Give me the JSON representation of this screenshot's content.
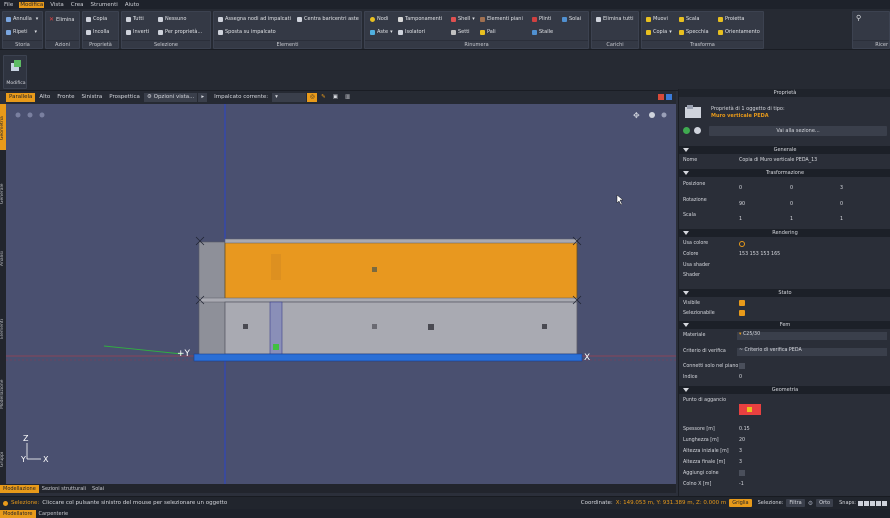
{
  "menu": [
    "File",
    "Modifica",
    "Vista",
    "Crea",
    "Strumenti",
    "Aiuto"
  ],
  "ribbon": {
    "storia": {
      "title": "Storia",
      "annulla": "Annulla",
      "ripeti": "Ripeti"
    },
    "azioni": {
      "title": "Azioni",
      "elimina": "Elimina"
    },
    "proprieta": {
      "title": "Proprietà",
      "copia": "Copia",
      "incolla": "Incolla"
    },
    "selezione": {
      "title": "Selezione",
      "tutti": "Tutti",
      "nessuno": "Nessuno",
      "inverti": "Inverti",
      "per_proprieta": "Per proprietà..."
    },
    "elementi": {
      "title": "Elementi",
      "assegna": "Assegna nodi ad impalcati",
      "centra": "Centra baricentri aste",
      "sposta": "Sposta su impalcato"
    },
    "rinumera": {
      "title": "Rinumera",
      "nodi": "Nodi",
      "tamponamenti": "Tamponamenti",
      "shell": "Shell",
      "elementi_piani": "Elementi piani",
      "plinti": "Plinti",
      "solai": "Solai",
      "aste": "Aste",
      "isolatori": "Isolatori",
      "setti": "Setti",
      "pali": "Pali",
      "stalle": "Stalle"
    },
    "carichi": {
      "title": "Carichi",
      "elimina_tutti": "Elimina tutti"
    },
    "trasforma": {
      "title": "Trasforma",
      "muovi": "Muovi",
      "scala": "Scala",
      "proietta": "Proietta",
      "copia": "Copia",
      "specchia": "Specchia",
      "orientamento": "Orientamento"
    },
    "ricerca": {
      "title": "Ricer"
    }
  },
  "modifica_button": "Modifica",
  "viewtabs": {
    "parallela": "Parallela",
    "alto": "Alto",
    "fronte": "Fronte",
    "sinistra": "Sinistra",
    "prospettica": "Prospettica",
    "opzioni": "Opzioni vista...",
    "impalcato_label": "Impalcato corrente:"
  },
  "side_tabs": [
    "Geometria",
    "Generale",
    "Analisi",
    "Elementi",
    "Modellazione",
    "Gruppi"
  ],
  "viewport": {
    "axis_x": "X",
    "axis_y": "+Y",
    "axis_z": "Z",
    "triad_y": "Y",
    "triad_x": "X"
  },
  "colors": {
    "accent": "#e89a1a",
    "slab_top": "#e8981f",
    "wall": "#a9aab2",
    "base": "#2a6fd6",
    "viewport_bg": "#4a5070"
  },
  "panel": {
    "title": "Proprietà",
    "summary_line1": "Proprietà di 1 oggetto di tipo:",
    "summary_type": "Muro verticale PEDA",
    "goto_section": "Vai alla sezione...",
    "generale": {
      "title": "Generale",
      "nome_label": "Nome",
      "nome_value": "Copia di Muro verticale PEDA_13"
    },
    "trasformazione": {
      "title": "Trasformazione",
      "posizione_label": "Posizione",
      "posizione": [
        "0",
        "0",
        "3"
      ],
      "rotazione_label": "Rotazione",
      "rotazione": [
        "90",
        "0",
        "0"
      ],
      "scala_label": "Scala",
      "scala": [
        "1",
        "1",
        "1"
      ]
    },
    "rendering": {
      "title": "Rendering",
      "usa_colore": "Usa colore",
      "colore_label": "Colore",
      "colore_value": "153 153 153 165",
      "usa_shader": "Usa shader",
      "shader": "Shader"
    },
    "stato": {
      "title": "Stato",
      "visibile": "Visibile",
      "selezionabile": "Selezionabile"
    },
    "fem": {
      "title": "Fem",
      "materiale_label": "Materiale",
      "materiale_value": "C25/30",
      "criterio_label": "Criterio di verifica",
      "criterio_value": "~ Criterio di verifica PEDA",
      "connetti_label": "Connetti solo nel piano",
      "indice_label": "Indice",
      "indice_value": "0"
    },
    "geometria": {
      "title": "Geometria",
      "punto_label": "Punto di aggancio",
      "spessore_label": "Spessore [m]",
      "spessore_value": "0.15",
      "lunghezza_label": "Lunghezza [m]",
      "lunghezza_value": "20",
      "altezza_iniziale_label": "Altezza iniziale [m]",
      "altezza_iniziale_value": "3",
      "altezza_finale_label": "Altezza finale [m]",
      "altezza_finale_value": "3",
      "aggiungi_colne_label": "Aggiungi colne",
      "colno_label": "Colno X [m]",
      "colno_value": "-1"
    }
  },
  "bottom_tabs": [
    "Modellazione",
    "Sezioni strutturali",
    "Solai"
  ],
  "status": {
    "label": "Selezione:",
    "text": "Cliccare col pulsante sinistro del mouse per selezionare un oggetto",
    "coord_label": "Coordinate:",
    "coord_value": "X: 149.053 m, Y: 931.389 m, Z: 0.000 m",
    "griglia": "Griglia",
    "selezione": "Selezione:",
    "filtra": "Filtra",
    "orto": "Orto",
    "snaps": "Snaps:"
  },
  "last_tabs": [
    "Modellatore",
    "Carpenterie"
  ]
}
